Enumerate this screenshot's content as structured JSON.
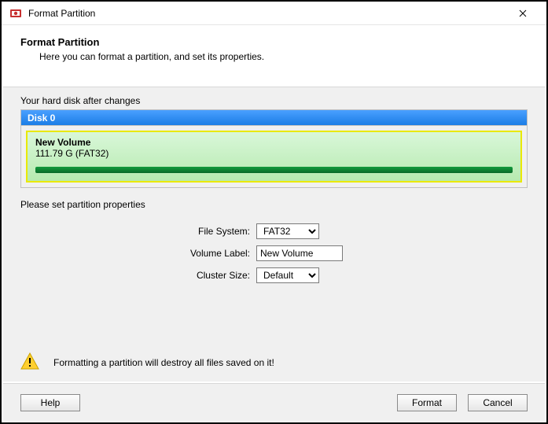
{
  "titlebar": {
    "title": "Format Partition"
  },
  "header": {
    "title": "Format Partition",
    "subtitle": "Here you can format a partition, and set its properties."
  },
  "disk_area": {
    "caption": "Your hard disk after changes",
    "disk_label": "Disk 0",
    "volume": {
      "name": "New Volume",
      "info": "111.79 G  (FAT32)"
    }
  },
  "props": {
    "caption": "Please set partition properties",
    "file_system": {
      "label": "File System:",
      "value": "FAT32"
    },
    "volume_label": {
      "label": "Volume Label:",
      "value": "New Volume"
    },
    "cluster_size": {
      "label": "Cluster Size:",
      "value": "Default"
    }
  },
  "warning": {
    "text": "Formatting a partition will destroy all files saved on it!"
  },
  "buttons": {
    "help": "Help",
    "format": "Format",
    "cancel": "Cancel"
  }
}
